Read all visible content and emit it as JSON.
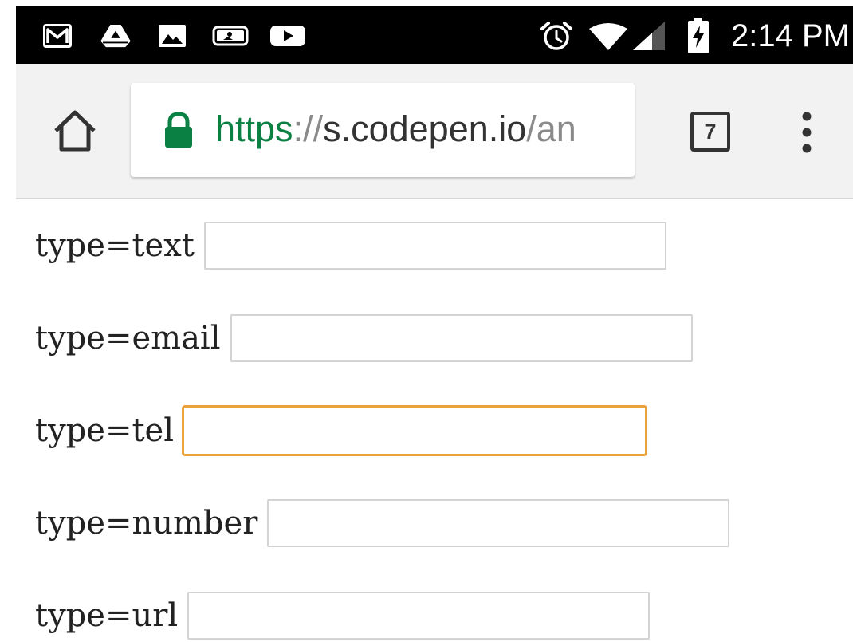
{
  "status_bar": {
    "time": "2:14 PM",
    "icons": [
      "gmail-icon",
      "drive-icon",
      "photos-icon",
      "mlb-icon",
      "youtube-icon",
      "alarm-icon",
      "wifi-icon",
      "signal-icon",
      "battery-charging-icon"
    ]
  },
  "toolbar": {
    "url_scheme": "https",
    "url_separator": "://",
    "url_host": "s.codepen.io",
    "url_path": "/an",
    "tab_count": "7"
  },
  "form": {
    "fields": [
      {
        "label": "type=text",
        "value": "",
        "focused": false
      },
      {
        "label": "type=email",
        "value": "",
        "focused": false
      },
      {
        "label": "type=tel",
        "value": "",
        "focused": true
      },
      {
        "label": "type=number",
        "value": "",
        "focused": false
      },
      {
        "label": "type=url",
        "value": "",
        "focused": false
      }
    ]
  },
  "colors": {
    "secure_green": "#0b8043",
    "focus_outline": "#e8a33a",
    "status_bar": "#000000",
    "toolbar_bg": "#f2f2f2"
  }
}
